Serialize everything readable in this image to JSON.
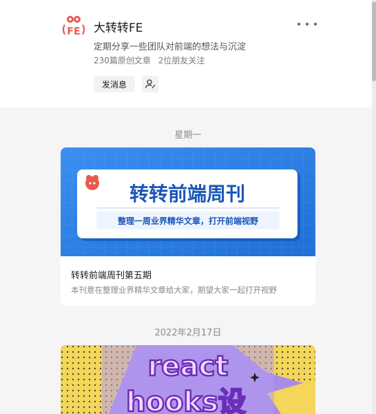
{
  "account": {
    "logo_text": "FE",
    "name": "大转转FE",
    "description": "定期分享一些团队对前端的想法与沉淀",
    "articles_count": "230篇原创文章",
    "friends_following": "2位朋友关注",
    "message_button": "发消息",
    "more_icon": "more-dots-icon",
    "follow_icon": "user-follow-icon"
  },
  "feed": [
    {
      "date": "星期一",
      "cover": {
        "headline": "转转前端周刊",
        "tagline": "整理一周业界精华文章，打开前端视野"
      },
      "title": "转转前端周刊第五期",
      "summary": "本刊意在整理业界精华文章给大家，期望大家一起打开视野"
    },
    {
      "date": "2022年2月17日",
      "cover": {
        "line1": "react",
        "line2": "hooks设"
      }
    }
  ],
  "colors": {
    "brand_red": "#e95a4e",
    "cover_blue": "#2b7fe3",
    "cover_text_blue": "#1a56b8",
    "cover_purple": "#a98be8",
    "cover_yellow": "#f3d65a"
  }
}
